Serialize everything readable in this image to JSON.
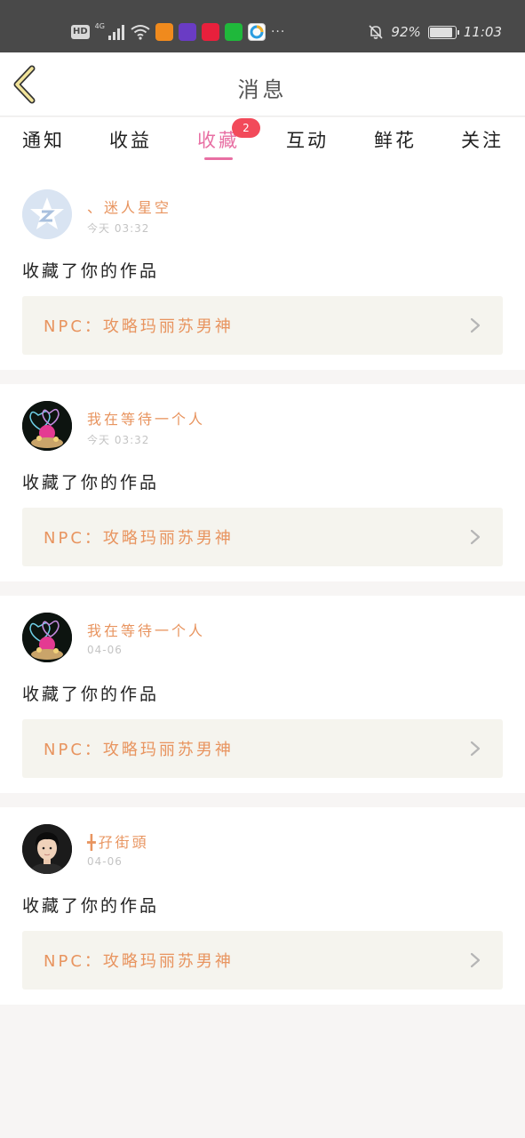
{
  "status_bar": {
    "hd": "HD",
    "network": "4G",
    "battery": "92%",
    "battery_level": 0.92,
    "time": "11:03",
    "more": "···"
  },
  "header": {
    "title": "消息",
    "back_icon": "chevron-left-icon"
  },
  "tabs": [
    {
      "label": "通知",
      "active": false
    },
    {
      "label": "收益",
      "active": false
    },
    {
      "label": "收藏",
      "active": true,
      "badge": "2"
    },
    {
      "label": "互动",
      "active": false
    },
    {
      "label": "鲜花",
      "active": false
    },
    {
      "label": "关注",
      "active": false
    }
  ],
  "messages": [
    {
      "user": "、迷人星空",
      "time": "今天 03:32",
      "action": "收藏了你的作品",
      "work": "NPC：攻略玛丽苏男神",
      "avatar": "qzone-avatar"
    },
    {
      "user": "我在等待一个人",
      "time": "今天 03:32",
      "action": "收藏了你的作品",
      "work": "NPC：攻略玛丽苏男神",
      "avatar": "heart-flower-avatar"
    },
    {
      "user": "我在等待一个人",
      "time": "04-06",
      "action": "收藏了你的作品",
      "work": "NPC：攻略玛丽苏男神",
      "avatar": "heart-flower-avatar"
    },
    {
      "user": "╋孖街頭",
      "time": "04-06",
      "action": "收藏了你的作品",
      "work": "NPC：攻略玛丽苏男神",
      "avatar": "boy-portrait-avatar"
    }
  ],
  "colors": {
    "accent": "#e86fa3",
    "badge": "#f24a5a",
    "username": "#e8945f",
    "card_link_bg": "#f5f4ee"
  }
}
